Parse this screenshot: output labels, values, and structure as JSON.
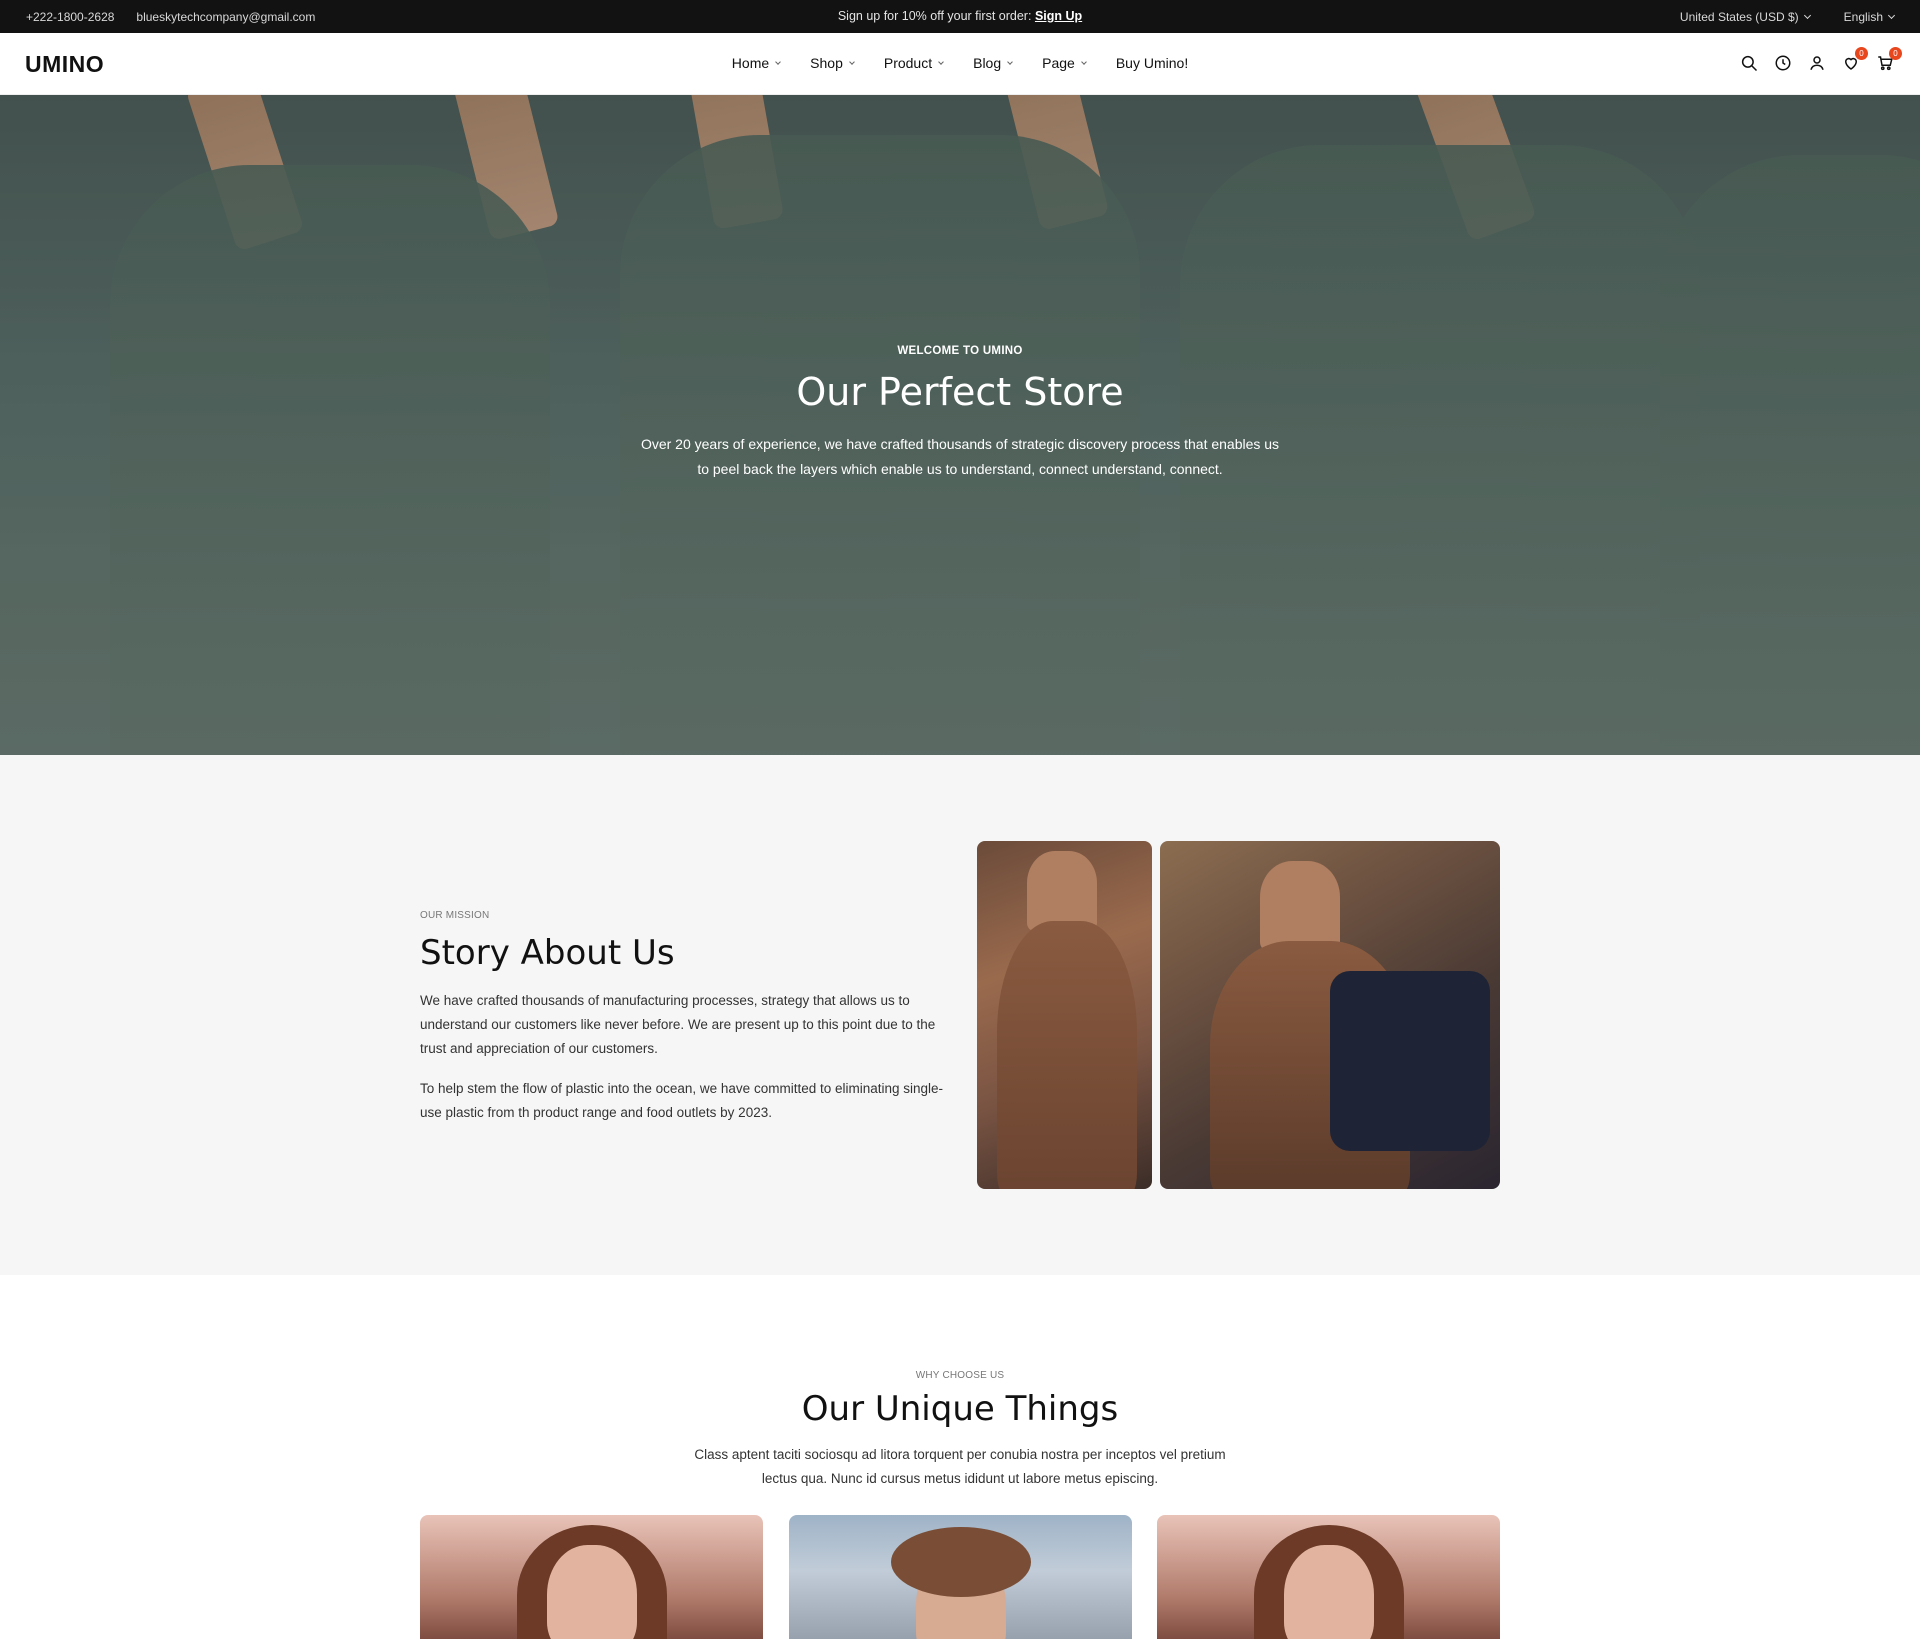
{
  "topbar": {
    "phone": "+222-1800-2628",
    "email": "blueskytechcompany@gmail.com",
    "promo_text": "Sign up for 10% off your first order:",
    "promo_link": "Sign Up",
    "currency": "United States (USD $)",
    "language": "English"
  },
  "header": {
    "logo": "UMINO",
    "nav": [
      {
        "label": "Home"
      },
      {
        "label": "Shop"
      },
      {
        "label": "Product"
      },
      {
        "label": "Blog"
      },
      {
        "label": "Page"
      },
      {
        "label": "Buy Umino!"
      }
    ],
    "wishlist_count": "0",
    "cart_count": "0"
  },
  "hero": {
    "kicker": "WELCOME TO UMINO",
    "title": "Our Perfect Store",
    "text": "Over 20 years of experience, we have crafted thousands of strategic discovery process that enables us to peel back the layers which enable us to understand, connect understand, connect."
  },
  "story": {
    "kicker": "OUR MISSION",
    "title": "Story About Us",
    "para1": "We have crafted thousands of manufacturing processes, strategy that allows us to understand our customers like never before. We are present up to this point due to the trust and appreciation of our customers.",
    "para2": "To help stem the flow of plastic into the ocean, we have committed to eliminating single-use plastic from th product range and food outlets by 2023."
  },
  "unique": {
    "kicker": "WHY CHOOSE US",
    "title": "Our Unique Things",
    "text": "Class aptent taciti sociosqu ad litora torquent per conubia nostra per inceptos vel pretium lectus qua. Nunc id cursus metus ididunt ut labore metus episcing."
  },
  "colors": {
    "topbar_bg": "#121212",
    "badge": "#e8461d",
    "story_bg": "#f6f6f6"
  }
}
